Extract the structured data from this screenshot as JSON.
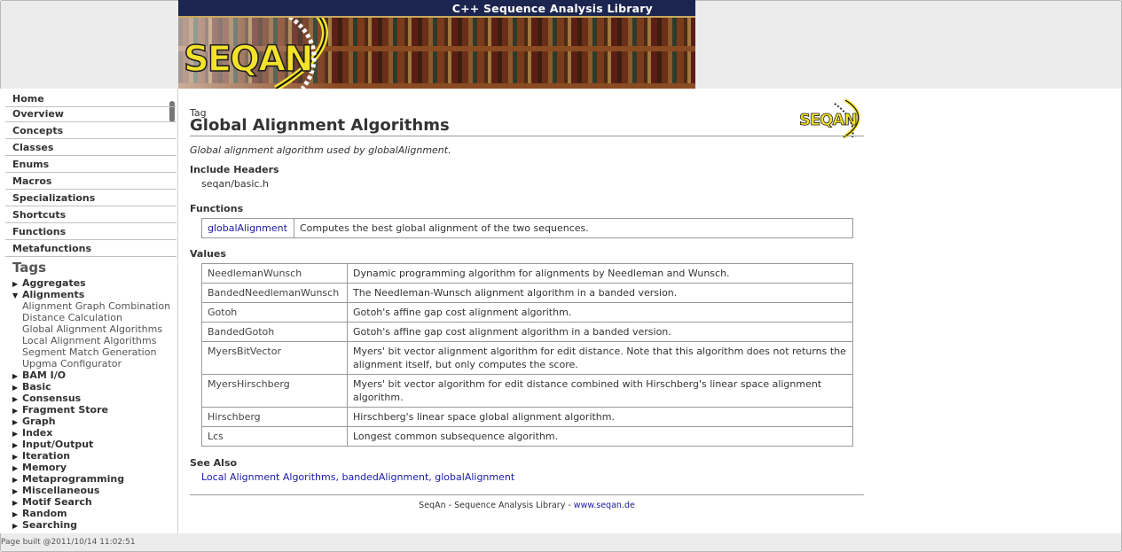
{
  "banner": {
    "title": "C++ Sequence Analysis Library",
    "logo_text": "SEQAN"
  },
  "sidebar": {
    "nav": [
      {
        "label": "Home"
      },
      {
        "label": "Overview"
      },
      {
        "label": "Concepts"
      },
      {
        "label": "Classes"
      },
      {
        "label": "Enums"
      },
      {
        "label": "Macros"
      },
      {
        "label": "Specializations"
      },
      {
        "label": "Shortcuts"
      },
      {
        "label": "Functions"
      },
      {
        "label": "Metafunctions"
      }
    ],
    "tags_heading": "Tags",
    "tags": [
      {
        "label": "Aggregates",
        "icon": "triangle-right-icon"
      },
      {
        "label": "Alignments",
        "icon": "triangle-down-icon",
        "children": [
          "Alignment Graph Combination",
          "Distance Calculation",
          "Global Alignment Algorithms",
          "Local Alignment Algorithms",
          "Segment Match Generation",
          "Upgma Configurator"
        ]
      },
      {
        "label": "BAM I/O",
        "icon": "triangle-right-icon"
      },
      {
        "label": "Basic",
        "icon": "triangle-right-icon"
      },
      {
        "label": "Consensus",
        "icon": "triangle-right-icon"
      },
      {
        "label": "Fragment Store",
        "icon": "triangle-right-icon"
      },
      {
        "label": "Graph",
        "icon": "triangle-right-icon"
      },
      {
        "label": "Index",
        "icon": "triangle-right-icon"
      },
      {
        "label": "Input/Output",
        "icon": "triangle-right-icon"
      },
      {
        "label": "Iteration",
        "icon": "triangle-right-icon"
      },
      {
        "label": "Memory",
        "icon": "triangle-right-icon"
      },
      {
        "label": "Metaprogramming",
        "icon": "triangle-right-icon"
      },
      {
        "label": "Miscellaneous",
        "icon": "triangle-right-icon"
      },
      {
        "label": "Motif Search",
        "icon": "triangle-right-icon"
      },
      {
        "label": "Random",
        "icon": "triangle-right-icon"
      },
      {
        "label": "Searching",
        "icon": "triangle-right-icon"
      }
    ],
    "page_built": "Page built @2011/10/14 11:02:51"
  },
  "main": {
    "kind": "Tag",
    "title": "Global Alignment Algorithms",
    "logo_text": "SEQAN",
    "description": "Global alignment algorithm used by globalAlignment.",
    "include_headers_heading": "Include Headers",
    "include_header": "seqan/basic.h",
    "functions_heading": "Functions",
    "functions": [
      {
        "name": "globalAlignment",
        "desc": "Computes the best global alignment of the two sequences."
      }
    ],
    "values_heading": "Values",
    "values": [
      {
        "name": "NeedlemanWunsch",
        "desc": "Dynamic programming algorithm for alignments by Needleman and Wunsch."
      },
      {
        "name": "BandedNeedlemanWunsch",
        "desc": "The Needleman-Wunsch alignment algorithm in a banded version."
      },
      {
        "name": "Gotoh",
        "desc": "Gotoh's affine gap cost alignment algorithm."
      },
      {
        "name": "BandedGotoh",
        "desc": "Gotoh's affine gap cost alignment algorithm in a banded version."
      },
      {
        "name": "MyersBitVector",
        "desc": "Myers' bit vector alignment algorithm for edit distance. Note that this algorithm does not returns the alignment itself, but only computes the score."
      },
      {
        "name": "MyersHirschberg",
        "desc": "Myers' bit vector algorithm for edit distance combined with Hirschberg's linear space alignment algorithm."
      },
      {
        "name": "Hirschberg",
        "desc": "Hirschberg's linear space global alignment algorithm."
      },
      {
        "name": "Lcs",
        "desc": "Longest common subsequence algorithm."
      }
    ],
    "see_also_heading": "See Also",
    "see_also": [
      {
        "label": "Local Alignment Algorithms",
        "sep": ", "
      },
      {
        "label": "bandedAlignment",
        "sep": ", "
      },
      {
        "label": "globalAlignment",
        "sep": ""
      }
    ],
    "footer_text": "SeqAn - Sequence Analysis Library - ",
    "footer_link": "www.seqan.de"
  },
  "colors": {
    "link": "#1a1aa6",
    "banner_bar": "#1b2550",
    "logo_yellow": "#f2e22a"
  }
}
